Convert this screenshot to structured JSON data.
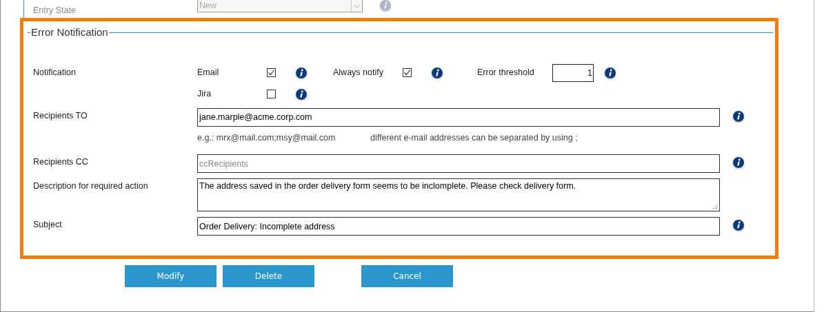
{
  "entry_state": {
    "label": "Entry State",
    "value": "New",
    "disabled": true
  },
  "error_notification": {
    "title": "Error Notification",
    "notification": {
      "label": "Notification",
      "options": [
        {
          "label": "Email",
          "checked": true
        },
        {
          "label": "Always notify",
          "checked": true
        },
        {
          "label": "Jira",
          "checked": false
        }
      ],
      "error_threshold": {
        "label": "Error threshold",
        "value": "1"
      }
    },
    "fields": [
      {
        "kind": "input",
        "label": "Recipients TO",
        "value": "jane.marple@acme.corp.com",
        "info": true,
        "hints": [
          "e.g.: mrx@mail.com;msy@mail.com",
          "different e-mail addresses can be separated by using ;"
        ]
      },
      {
        "kind": "input",
        "label": "Recipients CC",
        "placeholder": "ccRecipients",
        "info": true
      },
      {
        "kind": "textarea",
        "label": "Description for required action",
        "value": "The address saved in the order delivery form seems to be inclomplete. Please check delivery form.",
        "info": false
      },
      {
        "kind": "input",
        "label": "Subject",
        "value": "Order Delivery: Incomplete address",
        "info": true
      }
    ]
  },
  "buttons": [
    "Modify",
    "Delete",
    "Cancel"
  ]
}
